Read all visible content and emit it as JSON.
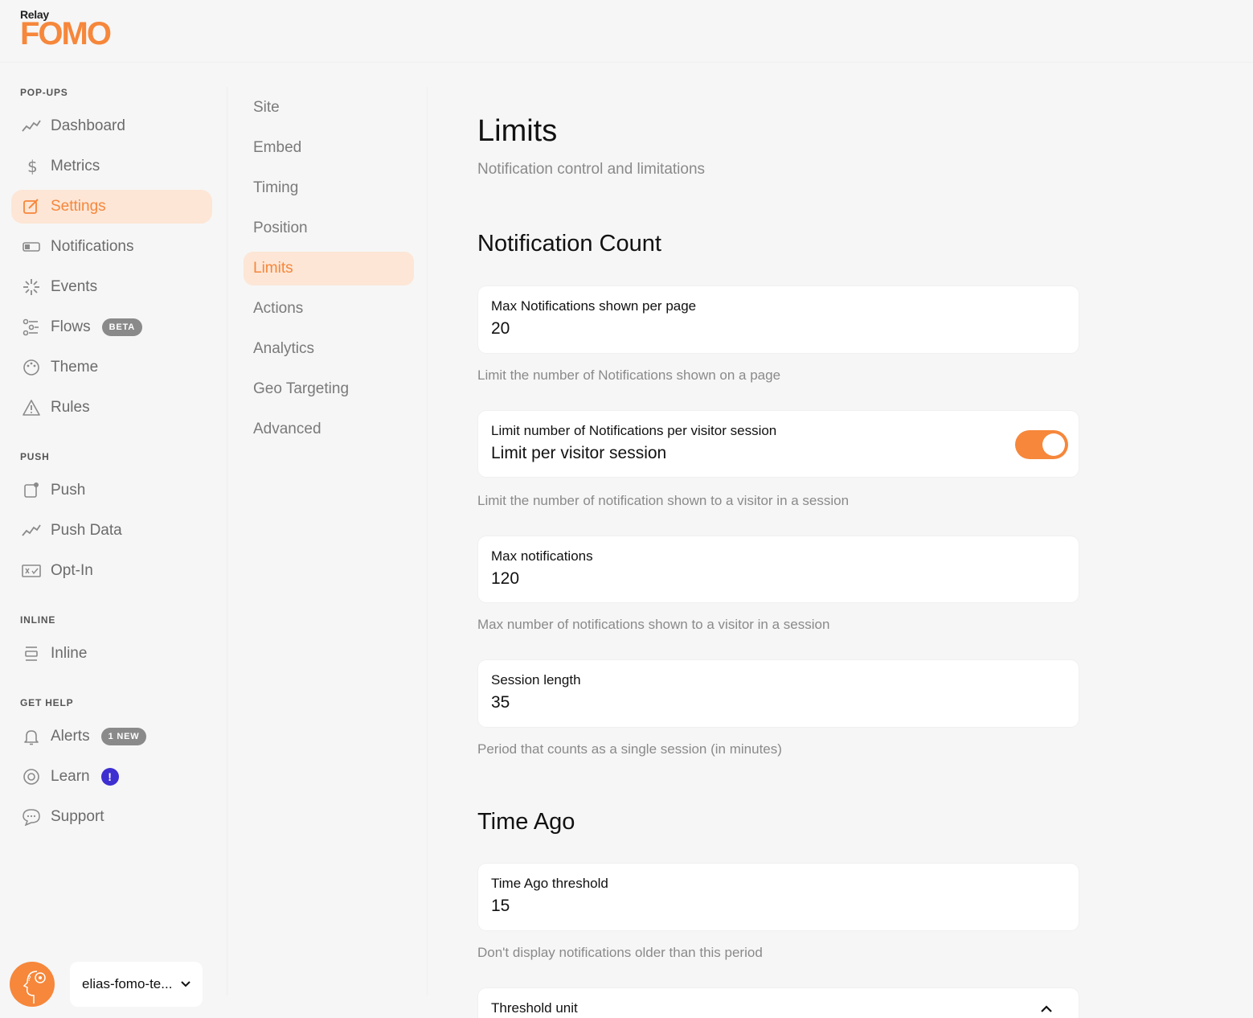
{
  "brand": {
    "relay": "Relay",
    "fomo": "FOMO"
  },
  "sidebar": {
    "sections": {
      "popups": "POP-UPS",
      "push": "PUSH",
      "inline": "INLINE",
      "help": "GET HELP"
    },
    "items": [
      {
        "label": "Dashboard",
        "icon": "trend-line-icon"
      },
      {
        "label": "Metrics",
        "icon": "dollar-icon"
      },
      {
        "label": "Settings",
        "icon": "edit-icon",
        "active": true
      },
      {
        "label": "Notifications",
        "icon": "toggle-icon"
      },
      {
        "label": "Events",
        "icon": "sparkle-icon"
      },
      {
        "label": "Flows",
        "icon": "flow-icon",
        "badge": "BETA"
      },
      {
        "label": "Theme",
        "icon": "palette-icon"
      },
      {
        "label": "Rules",
        "icon": "warning-icon"
      },
      {
        "label": "Push",
        "icon": "push-icon"
      },
      {
        "label": "Push Data",
        "icon": "trend-line-icon"
      },
      {
        "label": "Opt-In",
        "icon": "optin-icon"
      },
      {
        "label": "Inline",
        "icon": "inline-icon"
      },
      {
        "label": "Alerts",
        "icon": "bell-icon",
        "badge": "1 NEW"
      },
      {
        "label": "Learn",
        "icon": "lifebuoy-icon",
        "badge": "!"
      },
      {
        "label": "Support",
        "icon": "chat-icon"
      }
    ],
    "account": {
      "name": "elias-fomo-te..."
    }
  },
  "subnav": {
    "items": [
      "Site",
      "Embed",
      "Timing",
      "Position",
      "Limits",
      "Actions",
      "Analytics",
      "Geo Targeting",
      "Advanced"
    ],
    "active": "Limits"
  },
  "main": {
    "title": "Limits",
    "subtitle": "Notification control and limitations",
    "notification_count": {
      "title": "Notification Count",
      "max_per_page": {
        "label": "Max Notifications shown per page",
        "value": "20",
        "help": "Limit the number of Notifications shown on a page"
      },
      "limit_session": {
        "label": "Limit number of Notifications per visitor session",
        "value": "Limit per visitor session",
        "enabled": true,
        "help": "Limit the number of notification shown to a visitor in a session"
      },
      "max_notifications": {
        "label": "Max notifications",
        "value": "120",
        "help": "Max number of notifications shown to a visitor in a session"
      },
      "session_length": {
        "label": "Session length",
        "value": "35",
        "help": "Period that counts as a single session (in minutes)"
      }
    },
    "time_ago": {
      "title": "Time Ago",
      "threshold": {
        "label": "Time Ago threshold",
        "value": "15",
        "help": "Don't display notifications older than this period"
      },
      "threshold_unit": {
        "label": "Threshold unit"
      }
    }
  },
  "colors": {
    "accent": "#f6873b",
    "accent_bg": "#fde6d6",
    "learn_badge": "#3d2fd0"
  }
}
